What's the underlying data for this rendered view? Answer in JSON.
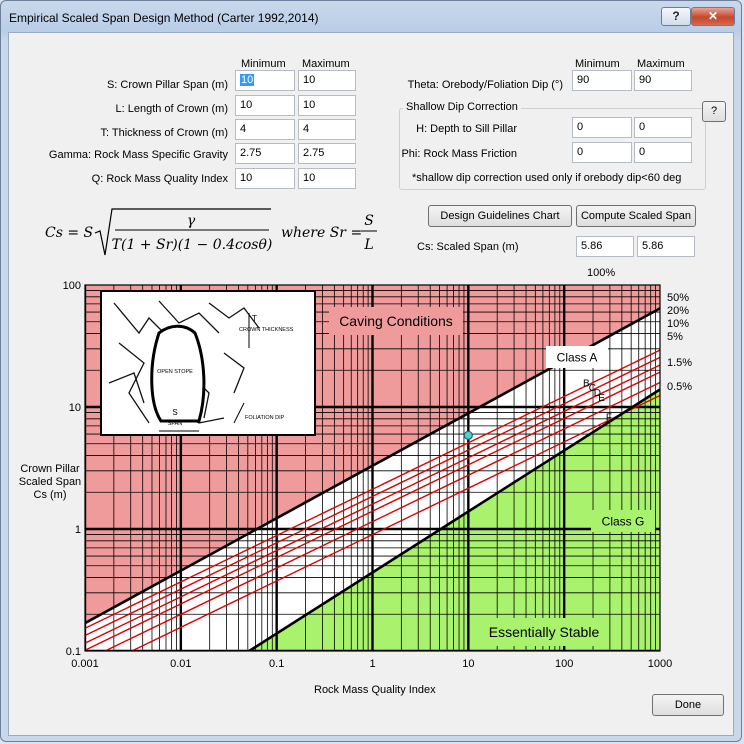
{
  "window": {
    "title": "Empirical Scaled Span Design Method (Carter 1992,2014)",
    "help_glyph": "?",
    "close_glyph": "✕"
  },
  "inputs": {
    "min_header": "Minimum",
    "max_header": "Maximum",
    "rows": [
      {
        "label": "S: Crown Pillar Span (m)",
        "min": "10",
        "max": "10"
      },
      {
        "label": "L: Length of Crown (m)",
        "min": "10",
        "max": "10"
      },
      {
        "label": "T: Thickness of Crown (m)",
        "min": "4",
        "max": "4"
      },
      {
        "label": "Gamma: Rock Mass Specific Gravity",
        "min": "2.75",
        "max": "2.75"
      },
      {
        "label": "Q: Rock Mass Quality Index",
        "min": "10",
        "max": "10"
      }
    ]
  },
  "theta": {
    "label": "Theta: Orebody/Foliation Dip (°)",
    "min_header": "Minimum",
    "max_header": "Maximum",
    "min": "90",
    "max": "90"
  },
  "shallow_dip": {
    "group_title": "Shallow Dip Correction",
    "help_label": "?",
    "rows": [
      {
        "label": "H: Depth to Sill Pillar",
        "min": "0",
        "max": "0"
      },
      {
        "label": "Phi: Rock Mass Friction",
        "min": "0",
        "max": "0"
      }
    ],
    "note": "*shallow dip correction used only if orebody dip<60 deg"
  },
  "formula": {
    "cs": "Cs = S",
    "numerator": "γ",
    "denominator": "T(1 + Sr)(1 − 0.4cosθ)",
    "where": "where Sr =",
    "frac_top": "S",
    "frac_bottom": "L"
  },
  "buttons": {
    "design_guidelines": "Design Guidelines Chart",
    "compute": "Compute Scaled Span",
    "done": "Done"
  },
  "result": {
    "label": "Cs: Scaled Span (m)",
    "min": "5.86",
    "max": "5.86"
  },
  "colors": {
    "caving": "#f09b9b",
    "stable": "#a8f26d",
    "red_line": "#e00000",
    "point": "#4fd0d0"
  },
  "chart_data": {
    "type": "scatter",
    "x_scale": "log",
    "y_scale": "log",
    "xlim": [
      0.001,
      1000
    ],
    "ylim": [
      0.1,
      100
    ],
    "xlabel": "Rock Mass Quality Index",
    "ylabel": "Crown Pillar Scaled Span Cs (m)",
    "x_ticks": [
      "0.001",
      "0.01",
      "0.1",
      "1",
      "10",
      "100",
      "1000"
    ],
    "y_ticks": [
      "100",
      "10",
      "1",
      "0.1"
    ],
    "point": {
      "x": 10,
      "y": 5.86
    },
    "regions": [
      {
        "label": "Caving Conditions",
        "boundary": "Sc = 3.3 Q^0.43"
      },
      {
        "label": "Essentially Stable",
        "boundary": "Sc = 0.44 Q^0.5"
      },
      {
        "label": "Class A"
      },
      {
        "label": "Class G"
      }
    ],
    "boundary_lines": [
      {
        "coef": 3.3,
        "exp": 0.43
      },
      {
        "coef": 0.44,
        "exp": 0.5
      }
    ],
    "probability_lines": [
      {
        "label": "50%",
        "coef": 2.12,
        "exp": 0.38,
        "class": "B"
      },
      {
        "label": "20%",
        "coef": 1.85,
        "exp": 0.38,
        "class": "C"
      },
      {
        "label": "10%",
        "coef": 1.6,
        "exp": 0.38,
        "class": "D"
      },
      {
        "label": "5%",
        "coef": 1.4,
        "exp": 0.38,
        "class": "E"
      },
      {
        "label": "1.5%",
        "coef": 1.15,
        "exp": 0.38,
        "class": ""
      },
      {
        "label": "0.5%",
        "coef": 0.9,
        "exp": 0.38,
        "class": "F"
      }
    ],
    "top_label": "100%",
    "inset_labels": {
      "thickness": "CROWN THICKNESS",
      "thickness_symbol": "T",
      "stope": "OPEN STOPE",
      "span_symbol": "S",
      "span": "SPAN",
      "dip": "FOLIATION DIP"
    }
  }
}
